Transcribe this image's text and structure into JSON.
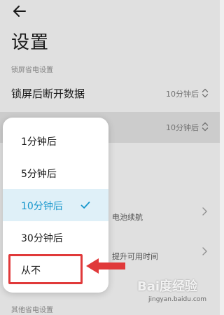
{
  "header": {
    "title": "设置"
  },
  "sections": {
    "lock_screen_power": "锁屏省电设置",
    "other_power": "其他省电设置"
  },
  "rows": [
    {
      "label": "锁屏后断开数据",
      "value": "10分钟后"
    },
    {
      "label": "",
      "value": "10分钟后"
    }
  ],
  "background_fragments": {
    "battery": "电池续航",
    "usage": "提升可用时间"
  },
  "dropdown": {
    "options": [
      "1分钟后",
      "5分钟后",
      "10分钟后",
      "30分钟后",
      "从不"
    ],
    "selected": "10分钟后",
    "highlighted_option": "从不"
  },
  "watermark": {
    "brand": "Bai度经验",
    "url": "jingyan.baidu.com"
  },
  "colors": {
    "accent": "#1596cc",
    "selected_bg": "#dff0f8",
    "annotation_red": "#e0393a"
  }
}
